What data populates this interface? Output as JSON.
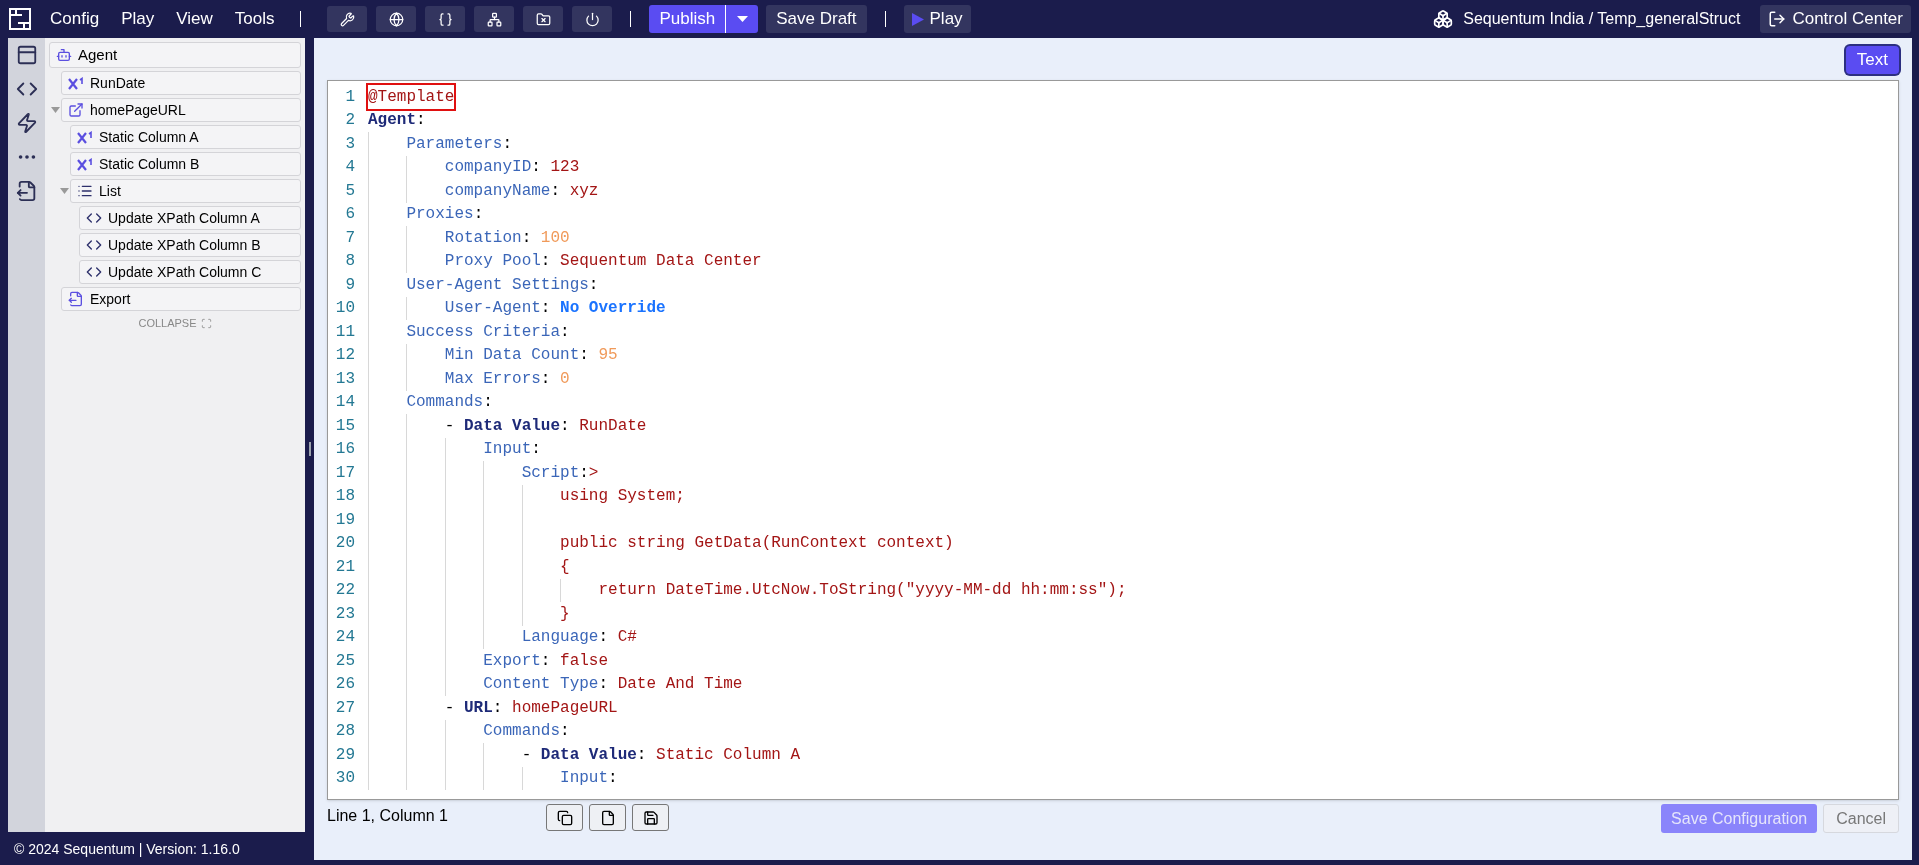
{
  "menu": [
    {
      "label": "Config"
    },
    {
      "label": "Play"
    },
    {
      "label": "View"
    },
    {
      "label": "Tools"
    }
  ],
  "toolbar": {
    "tools": [
      {
        "kind": "tools"
      },
      {
        "kind": "globe"
      },
      {
        "kind": "braces"
      },
      {
        "kind": "network"
      },
      {
        "kind": "folder-x"
      },
      {
        "kind": "power"
      }
    ],
    "publish": "Publish",
    "save_draft": "Save Draft",
    "play": "Play"
  },
  "project": "Sequentum India / Temp_generalStruct",
  "control_center": "Control Center",
  "rail": [
    {
      "kind": "panel"
    },
    {
      "kind": "code"
    },
    {
      "kind": "bolt"
    },
    {
      "kind": "more"
    },
    {
      "kind": "export"
    }
  ],
  "tree": [
    {
      "label": "Agent",
      "kind": "agent",
      "children": [
        {
          "label": "RunDate",
          "kind": "data"
        },
        {
          "label": "homePageURL",
          "kind": "url",
          "expanded": true,
          "children": [
            {
              "label": "Static Column A",
              "kind": "data"
            },
            {
              "label": "Static Column B",
              "kind": "data"
            },
            {
              "label": "List",
              "kind": "list",
              "expanded": true,
              "children": [
                {
                  "label": "Update XPath Column A",
                  "kind": "xpath"
                },
                {
                  "label": "Update XPath Column B",
                  "kind": "xpath"
                },
                {
                  "label": "Update XPath Column C",
                  "kind": "xpath"
                }
              ]
            }
          ]
        },
        {
          "label": "Export",
          "kind": "export"
        }
      ]
    }
  ],
  "collapse": "COLLAPSE",
  "footer": "© 2024 Sequentum | Version: 1.16.0",
  "view_mode": {
    "label": "Text",
    "selected": true
  },
  "editor": {
    "lines": [
      {
        "n": "1",
        "tokens": [
          {
            "kind": "template",
            "text": "@Template"
          }
        ]
      },
      {
        "n": "2",
        "tokens": [
          {
            "kind": "keybold",
            "text": "Agent"
          },
          {
            "kind": "punct",
            "text": ":"
          }
        ]
      },
      {
        "n": "3",
        "tokens": [
          {
            "kind": "key",
            "text": "    Parameters"
          },
          {
            "kind": "punct",
            "text": ":"
          }
        ]
      },
      {
        "n": "4",
        "tokens": [
          {
            "kind": "key",
            "text": "        companyID"
          },
          {
            "kind": "punct",
            "text": ": "
          },
          {
            "kind": "value",
            "text": "123"
          }
        ]
      },
      {
        "n": "5",
        "tokens": [
          {
            "kind": "key",
            "text": "        companyName"
          },
          {
            "kind": "punct",
            "text": ": "
          },
          {
            "kind": "value",
            "text": "xyz"
          }
        ]
      },
      {
        "n": "6",
        "tokens": [
          {
            "kind": "key",
            "text": "    Proxies"
          },
          {
            "kind": "punct",
            "text": ":"
          }
        ]
      },
      {
        "n": "7",
        "tokens": [
          {
            "kind": "key",
            "text": "        Rotation"
          },
          {
            "kind": "punct",
            "text": ": "
          },
          {
            "kind": "number",
            "text": "100"
          }
        ]
      },
      {
        "n": "8",
        "tokens": [
          {
            "kind": "key",
            "text": "        Proxy Pool"
          },
          {
            "kind": "punct",
            "text": ": "
          },
          {
            "kind": "value",
            "text": "Sequentum Data Center"
          }
        ]
      },
      {
        "n": "9",
        "tokens": [
          {
            "kind": "key",
            "text": "    User-Agent Settings"
          },
          {
            "kind": "punct",
            "text": ":"
          }
        ]
      },
      {
        "n": "10",
        "tokens": [
          {
            "kind": "key",
            "text": "        User-Agent"
          },
          {
            "kind": "punct",
            "text": ": "
          },
          {
            "kind": "constant",
            "text": "No Override"
          }
        ]
      },
      {
        "n": "11",
        "tokens": [
          {
            "kind": "key",
            "text": "    Success Criteria"
          },
          {
            "kind": "punct",
            "text": ":"
          }
        ]
      },
      {
        "n": "12",
        "tokens": [
          {
            "kind": "key",
            "text": "        Min Data Count"
          },
          {
            "kind": "punct",
            "text": ": "
          },
          {
            "kind": "number",
            "text": "95"
          }
        ]
      },
      {
        "n": "13",
        "tokens": [
          {
            "kind": "key",
            "text": "        Max Errors"
          },
          {
            "kind": "punct",
            "text": ": "
          },
          {
            "kind": "number",
            "text": "0"
          }
        ]
      },
      {
        "n": "14",
        "tokens": [
          {
            "kind": "key",
            "text": "    Commands"
          },
          {
            "kind": "punct",
            "text": ":"
          }
        ]
      },
      {
        "n": "15",
        "tokens": [
          {
            "kind": "punct",
            "text": "        - "
          },
          {
            "kind": "keybold",
            "text": "Data Value"
          },
          {
            "kind": "punct",
            "text": ": "
          },
          {
            "kind": "value",
            "text": "RunDate"
          }
        ]
      },
      {
        "n": "16",
        "tokens": [
          {
            "kind": "key",
            "text": "            Input"
          },
          {
            "kind": "punct",
            "text": ":"
          }
        ]
      },
      {
        "n": "17",
        "tokens": [
          {
            "kind": "key",
            "text": "                Script"
          },
          {
            "kind": "punct",
            "text": ":"
          },
          {
            "kind": "value",
            "text": ">"
          }
        ]
      },
      {
        "n": "18",
        "tokens": [
          {
            "kind": "value",
            "text": "                    using System;"
          }
        ]
      },
      {
        "n": "19"
      },
      {
        "n": "20",
        "tokens": [
          {
            "kind": "value",
            "text": "                    public string GetData(RunContext context)"
          }
        ]
      },
      {
        "n": "21",
        "tokens": [
          {
            "kind": "value",
            "text": "                    {"
          }
        ]
      },
      {
        "n": "22",
        "tokens": [
          {
            "kind": "value",
            "text": "                        return DateTime.UtcNow.ToString(\"yyyy-MM-dd hh:mm:ss\");"
          }
        ]
      },
      {
        "n": "23",
        "tokens": [
          {
            "kind": "value",
            "text": "                    }"
          }
        ]
      },
      {
        "n": "24",
        "tokens": [
          {
            "kind": "key",
            "text": "                Language"
          },
          {
            "kind": "punct",
            "text": ": "
          },
          {
            "kind": "value",
            "text": "C#"
          }
        ]
      },
      {
        "n": "25",
        "tokens": [
          {
            "kind": "key",
            "text": "            Export"
          },
          {
            "kind": "punct",
            "text": ": "
          },
          {
            "kind": "value",
            "text": "false"
          }
        ]
      },
      {
        "n": "26",
        "tokens": [
          {
            "kind": "key",
            "text": "            Content Type"
          },
          {
            "kind": "punct",
            "text": ": "
          },
          {
            "kind": "value",
            "text": "Date And Time"
          }
        ]
      },
      {
        "n": "27",
        "tokens": [
          {
            "kind": "punct",
            "text": "        - "
          },
          {
            "kind": "keybold",
            "text": "URL"
          },
          {
            "kind": "punct",
            "text": ": "
          },
          {
            "kind": "value",
            "text": "homePageURL"
          }
        ]
      },
      {
        "n": "28",
        "tokens": [
          {
            "kind": "key",
            "text": "            Commands"
          },
          {
            "kind": "punct",
            "text": ":"
          }
        ]
      },
      {
        "n": "29",
        "tokens": [
          {
            "kind": "punct",
            "text": "                - "
          },
          {
            "kind": "keybold",
            "text": "Data Value"
          },
          {
            "kind": "punct",
            "text": ": "
          },
          {
            "kind": "value",
            "text": "Static Column A"
          }
        ]
      },
      {
        "n": "30",
        "tokens": [
          {
            "kind": "key",
            "text": "                    Input"
          },
          {
            "kind": "punct",
            "text": ":"
          }
        ]
      }
    ],
    "status": "Line 1, Column 1",
    "actions": [
      {
        "kind": "copy"
      },
      {
        "kind": "file"
      },
      {
        "kind": "save"
      }
    ],
    "save": {
      "label": "Save Configuration",
      "disabled": true
    },
    "cancel": {
      "label": "Cancel",
      "disabled": true
    }
  }
}
